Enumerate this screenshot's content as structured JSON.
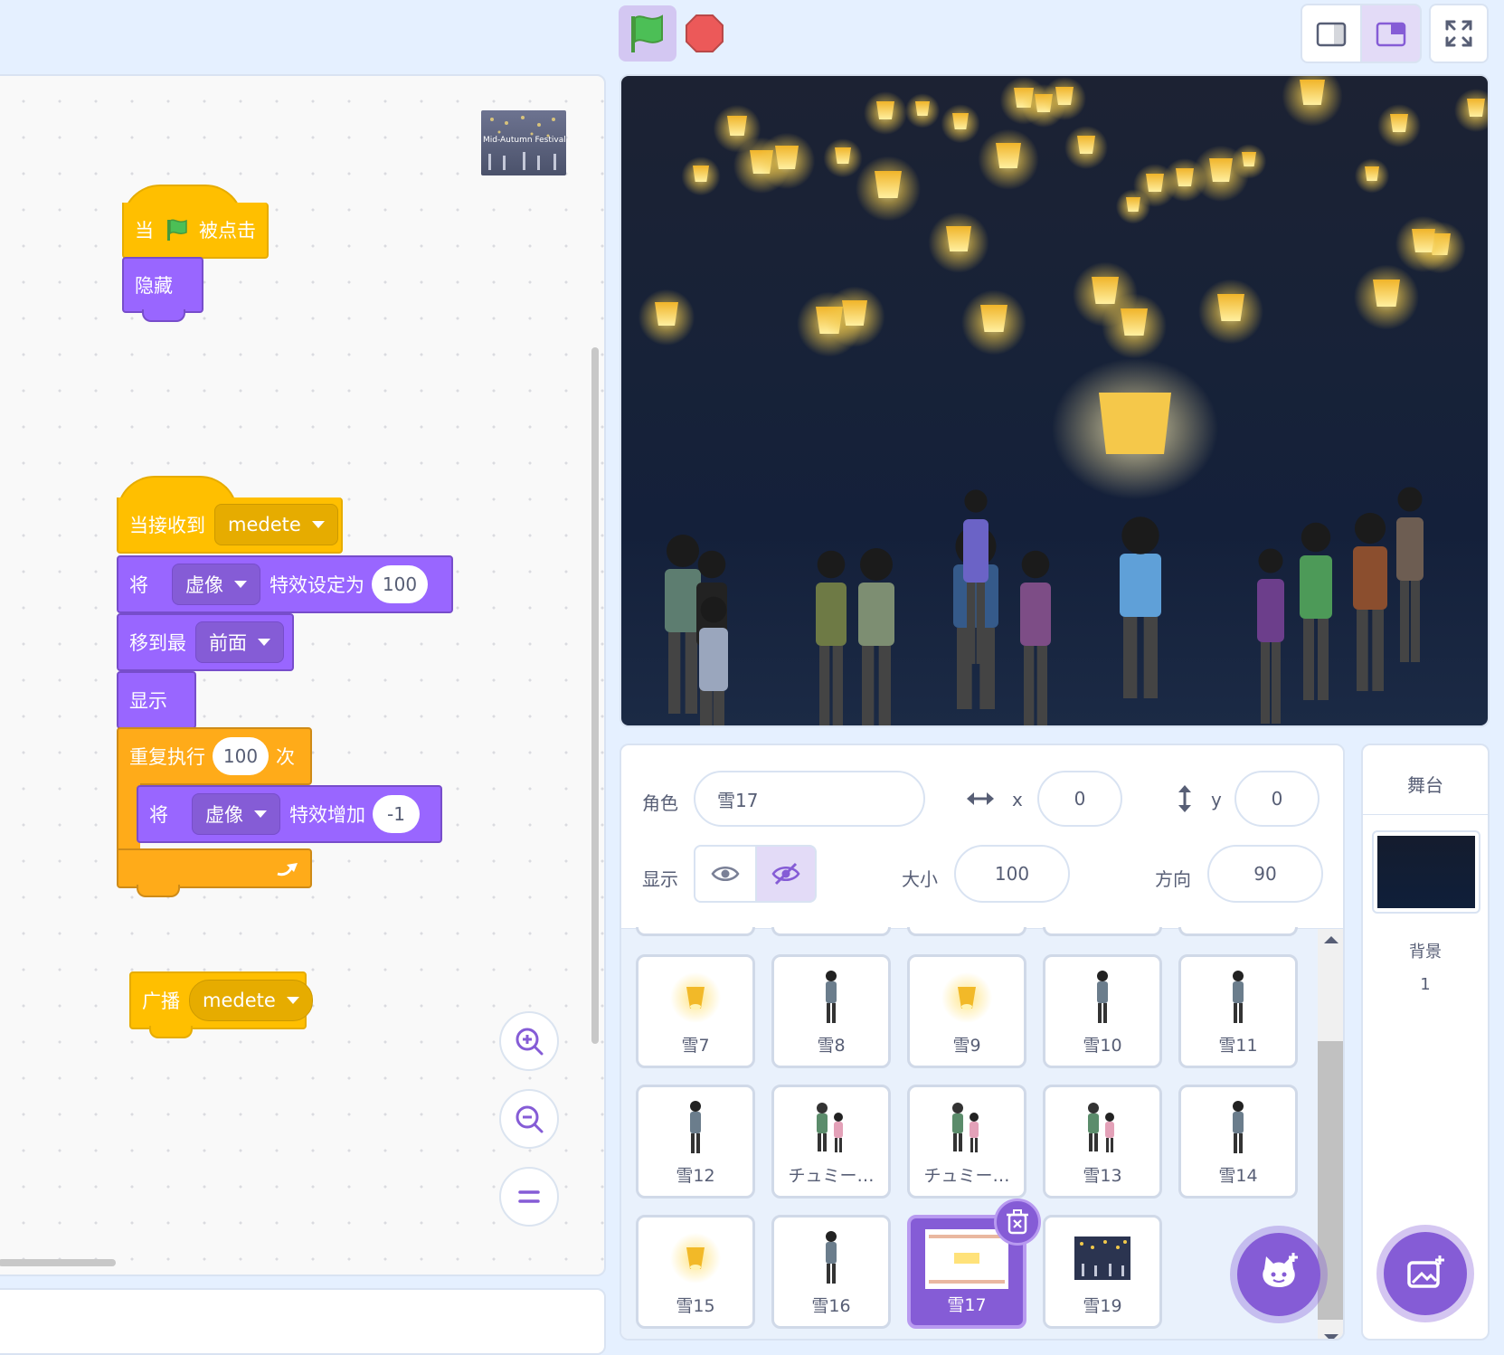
{
  "controls": {
    "green_flag": "green-flag",
    "stop": "stop-sign"
  },
  "layout_buttons": [
    "small-stage",
    "normal-stage",
    "fullscreen"
  ],
  "code": {
    "preview_label": "Mid-Autumn Festival",
    "script1": {
      "hat_when": "当",
      "hat_clicked": "被点击",
      "hide": "隐藏"
    },
    "script2": {
      "hat_receive": "当接收到",
      "hat_message": "medete",
      "set_prefix": "将",
      "set_effect": "虚像",
      "set_suffix": "特效设定为",
      "set_value": "100",
      "goto_prefix": "移到最",
      "goto_layer": "前面",
      "show": "显示",
      "repeat_prefix": "重复执行",
      "repeat_count": "100",
      "repeat_suffix": "次",
      "change_prefix": "将",
      "change_effect": "虚像",
      "change_suffix": "特效增加",
      "change_value": "-1"
    },
    "script3": {
      "broadcast": "广播",
      "broadcast_message": "medete"
    }
  },
  "sprite_info": {
    "sprite_label": "角色",
    "sprite_name": "雪17",
    "x_label": "x",
    "x_value": "0",
    "y_label": "y",
    "y_value": "0",
    "show_label": "显示",
    "size_label": "大小",
    "size_value": "100",
    "direction_label": "方向",
    "direction_value": "90"
  },
  "sprites": [
    {
      "name": "雪7",
      "kind": "lantern"
    },
    {
      "name": "雪8",
      "kind": "person"
    },
    {
      "name": "雪9",
      "kind": "lantern"
    },
    {
      "name": "雪10",
      "kind": "person"
    },
    {
      "name": "雪11",
      "kind": "person"
    },
    {
      "name": "雪12",
      "kind": "person"
    },
    {
      "name": "チュミー…",
      "kind": "group"
    },
    {
      "name": "チュミー…",
      "kind": "group"
    },
    {
      "name": "雪13",
      "kind": "group"
    },
    {
      "name": "雪14",
      "kind": "person"
    },
    {
      "name": "雪15",
      "kind": "lantern"
    },
    {
      "name": "雪16",
      "kind": "person"
    },
    {
      "name": "雪17",
      "kind": "card",
      "selected": true
    },
    {
      "name": "雪19",
      "kind": "photo"
    }
  ],
  "stage_pane": {
    "title": "舞台",
    "backdrops_label": "背景",
    "backdrops_count": "1"
  },
  "colors": {
    "events": "#ffbf00",
    "looks": "#9966ff",
    "control": "#ffab19",
    "accent": "#855cd6",
    "stop": "#ec5959"
  }
}
